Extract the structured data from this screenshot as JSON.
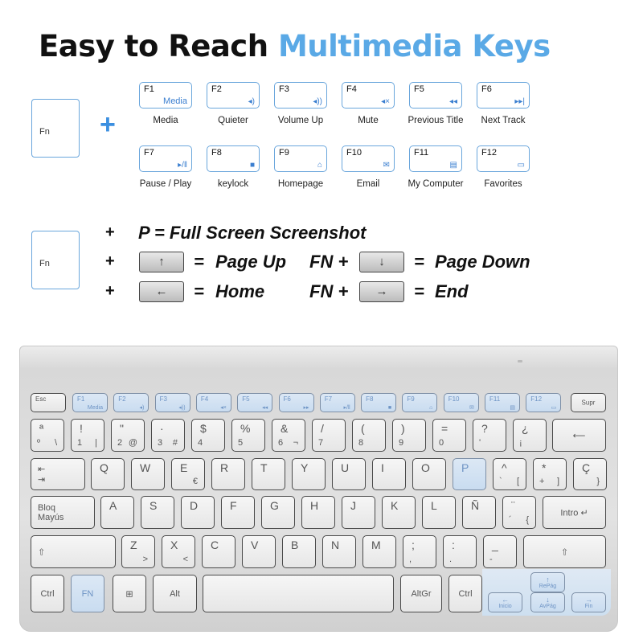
{
  "title": {
    "part1": "Easy to Reach ",
    "part2": "Multimedia Keys"
  },
  "colors": {
    "accent": "#5aa9e6",
    "key_border": "#6aa6dc",
    "highlight": "#c9dcf0"
  },
  "fn_label": "Fn",
  "plus": "+",
  "fkeys": [
    {
      "key": "F1",
      "icon": "Media",
      "icon_name": "media-text",
      "label": "Media"
    },
    {
      "key": "F2",
      "icon": "◂)",
      "icon_name": "volume-down-icon",
      "label": "Quieter"
    },
    {
      "key": "F3",
      "icon": "◂))",
      "icon_name": "volume-up-icon",
      "label": "Volume Up"
    },
    {
      "key": "F4",
      "icon": "◂×",
      "icon_name": "mute-icon",
      "label": "Mute"
    },
    {
      "key": "F5",
      "icon": "◂◂",
      "icon_name": "previous-track-icon",
      "label": "Previous Title"
    },
    {
      "key": "F6",
      "icon": "▸▸|",
      "icon_name": "next-track-icon",
      "label": "Next Track"
    },
    {
      "key": "F7",
      "icon": "▸/‖",
      "icon_name": "play-pause-icon",
      "label": "Pause / Play"
    },
    {
      "key": "F8",
      "icon": "■",
      "icon_name": "keylock-icon",
      "label": "keylock"
    },
    {
      "key": "F9",
      "icon": "⌂",
      "icon_name": "home-icon",
      "label": "Homepage"
    },
    {
      "key": "F10",
      "icon": "✉",
      "icon_name": "email-icon",
      "label": "Email"
    },
    {
      "key": "F11",
      "icon": "▤",
      "icon_name": "computer-icon",
      "label": "My Computer"
    },
    {
      "key": "F12",
      "icon": "▭",
      "icon_name": "folder-icon",
      "label": "Favorites"
    }
  ],
  "shortcuts": {
    "screenshot": "P = Full Screen Screenshot",
    "eq": "=",
    "fn_plus": "FN +",
    "page_up": "Page Up",
    "page_down": "Page Down",
    "home": "Home",
    "end": "End",
    "arrows": {
      "up": "↑",
      "down": "↓",
      "left": "←",
      "right": "→"
    }
  },
  "keyboard": {
    "frow": [
      {
        "t": "Esc"
      },
      {
        "t": "F1",
        "r": "Media",
        "hl": true
      },
      {
        "t": "F2",
        "r": "◂)",
        "hl": true
      },
      {
        "t": "F3",
        "r": "◂))",
        "hl": true
      },
      {
        "t": "F4",
        "r": "◂×",
        "hl": true
      },
      {
        "t": "F5",
        "r": "◂◂",
        "hl": true
      },
      {
        "t": "F6",
        "r": "▸▸",
        "hl": true
      },
      {
        "t": "F7",
        "r": "▸/‖",
        "hl": true
      },
      {
        "t": "F8",
        "r": "■",
        "hl": true
      },
      {
        "t": "F9",
        "r": "⌂",
        "hl": true
      },
      {
        "t": "F10",
        "r": "✉",
        "hl": true
      },
      {
        "t": "F11",
        "r": "▤",
        "hl": true
      },
      {
        "t": "F12",
        "r": "▭",
        "hl": true
      },
      {
        "m": "Supr"
      }
    ],
    "row1": [
      {
        "t": "ª",
        "b": "º",
        "r": "\\"
      },
      {
        "t": "!",
        "b": "1",
        "r": "|"
      },
      {
        "t": "\"",
        "b": "2",
        "r": "@"
      },
      {
        "t": "·",
        "b": "3",
        "r": "#"
      },
      {
        "t": "$",
        "b": "4"
      },
      {
        "t": "%",
        "b": "5"
      },
      {
        "t": "&",
        "b": "6",
        "r": "¬"
      },
      {
        "t": "/",
        "b": "7"
      },
      {
        "t": "(",
        "b": "8"
      },
      {
        "t": ")",
        "b": "9"
      },
      {
        "t": "=",
        "b": "0"
      },
      {
        "t": "?",
        "b": "'"
      },
      {
        "t": "¿",
        "b": "¡"
      },
      {
        "m": "⟵"
      }
    ],
    "row2": [
      {
        "ml": "⇤\n⇥"
      },
      {
        "t": "Q"
      },
      {
        "t": "W"
      },
      {
        "t": "E",
        "r": "€"
      },
      {
        "t": "R"
      },
      {
        "t": "T"
      },
      {
        "t": "Y"
      },
      {
        "t": "U"
      },
      {
        "t": "I"
      },
      {
        "t": "O"
      },
      {
        "t": "P",
        "hl": true
      },
      {
        "t": "^",
        "b": "`",
        "r": "["
      },
      {
        "t": "*",
        "b": "+",
        "r": "]"
      },
      {
        "t": "Ç",
        "r": "}"
      }
    ],
    "row3": [
      {
        "ml": "Bloq\nMayús"
      },
      {
        "t": "A"
      },
      {
        "t": "S"
      },
      {
        "t": "D"
      },
      {
        "t": "F"
      },
      {
        "t": "G"
      },
      {
        "t": "H"
      },
      {
        "t": "J"
      },
      {
        "t": "K"
      },
      {
        "t": "L"
      },
      {
        "t": "Ñ"
      },
      {
        "t": "¨",
        "b": "´",
        "r": "{"
      },
      {
        "m": "Intro ↵"
      }
    ],
    "row4": [
      {
        "ml": "⇧"
      },
      {
        "t": "Z",
        "r": ">"
      },
      {
        "t": "X",
        "r": "<"
      },
      {
        "t": "C"
      },
      {
        "t": "V"
      },
      {
        "t": "B"
      },
      {
        "t": "N"
      },
      {
        "t": "M"
      },
      {
        "t": ";",
        "b": ","
      },
      {
        "t": ":",
        "b": "."
      },
      {
        "t": "_",
        "b": "-"
      },
      {
        "m": "⇧"
      }
    ],
    "row5": [
      {
        "m": "Ctrl"
      },
      {
        "m": "FN",
        "hl": true
      },
      {
        "m": "⊞",
        "icon_name": "windows-icon"
      },
      {
        "m": "Alt"
      },
      {
        "m": ""
      },
      {
        "m": "AltGr"
      },
      {
        "m": "Ctrl"
      }
    ],
    "arrows": [
      {
        "t": "↑",
        "b": "RePág"
      },
      {
        "t": "←",
        "b": "Inicio"
      },
      {
        "t": "↓",
        "b": "AvPág"
      },
      {
        "t": "→",
        "b": "Fin"
      }
    ]
  }
}
